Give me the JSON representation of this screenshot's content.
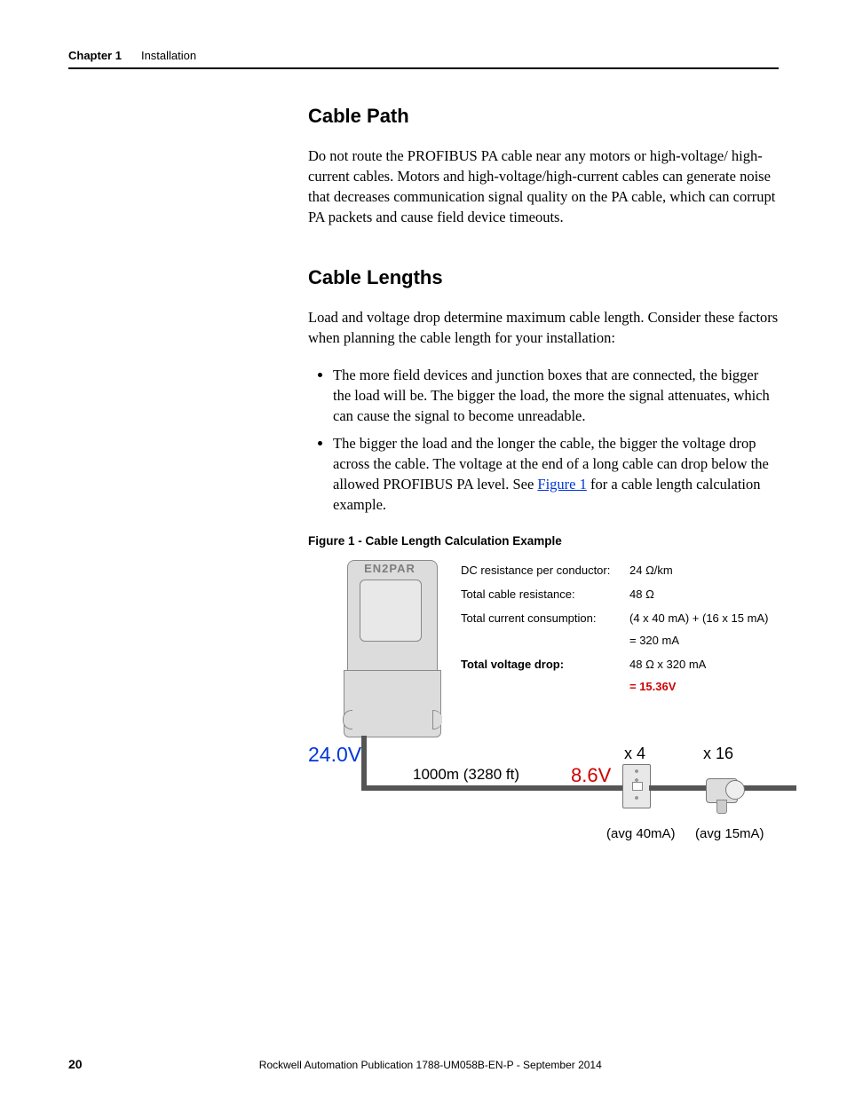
{
  "header": {
    "chapter": "Chapter 1",
    "section": "Installation"
  },
  "sections": {
    "cable_path": {
      "title": "Cable Path",
      "body": "Do not route the PROFIBUS PA cable near any motors or high-voltage/ high-current cables. Motors and high-voltage/high-current cables can generate noise that decreases communication signal quality on the PA cable, which can corrupt PA packets and cause field device timeouts."
    },
    "cable_lengths": {
      "title": "Cable Lengths",
      "intro": "Load and voltage drop determine maximum cable length. Consider these factors when planning the cable length for your installation:",
      "bullets": {
        "b1": "The more field devices and junction boxes that are connected, the bigger the load will be. The bigger the load, the more the signal attenuates, which can cause the signal to become unreadable.",
        "b2_pre": "The bigger the load and the longer the cable, the bigger the voltage drop across the cable. The voltage at the end of a long cable can drop below the allowed PROFIBUS PA level. See ",
        "b2_link": "Figure 1",
        "b2_post": " for a cable length calculation example."
      }
    }
  },
  "figure": {
    "caption": "Figure 1 - Cable Length Calculation Example",
    "module_label": "EN2PAR",
    "calc": {
      "r1_l": "DC resistance per conductor:",
      "r1_r": "24 Ω/km",
      "r2_l": "Total cable resistance:",
      "r2_r": "48 Ω",
      "r3_l": "Total current consumption:",
      "r3_r": "(4 x 40 mA) + (16 x 15 mA)",
      "r3b_r": "= 320 mA",
      "r4_l": "Total voltage drop:",
      "r4_r": "48 Ω x 320 mA",
      "r4b_r": "= 15.36V"
    },
    "diagram": {
      "volt_in": "24.0V",
      "cable_len": "1000m (3280 ft)",
      "volt_out": "8.6V",
      "x4": "x 4",
      "x16": "x 16",
      "avg1": "(avg 40mA)",
      "avg2": "(avg 15mA)"
    }
  },
  "footer": {
    "page": "20",
    "pub": "Rockwell Automation Publication 1788-UM058B-EN-P - September 2014"
  }
}
